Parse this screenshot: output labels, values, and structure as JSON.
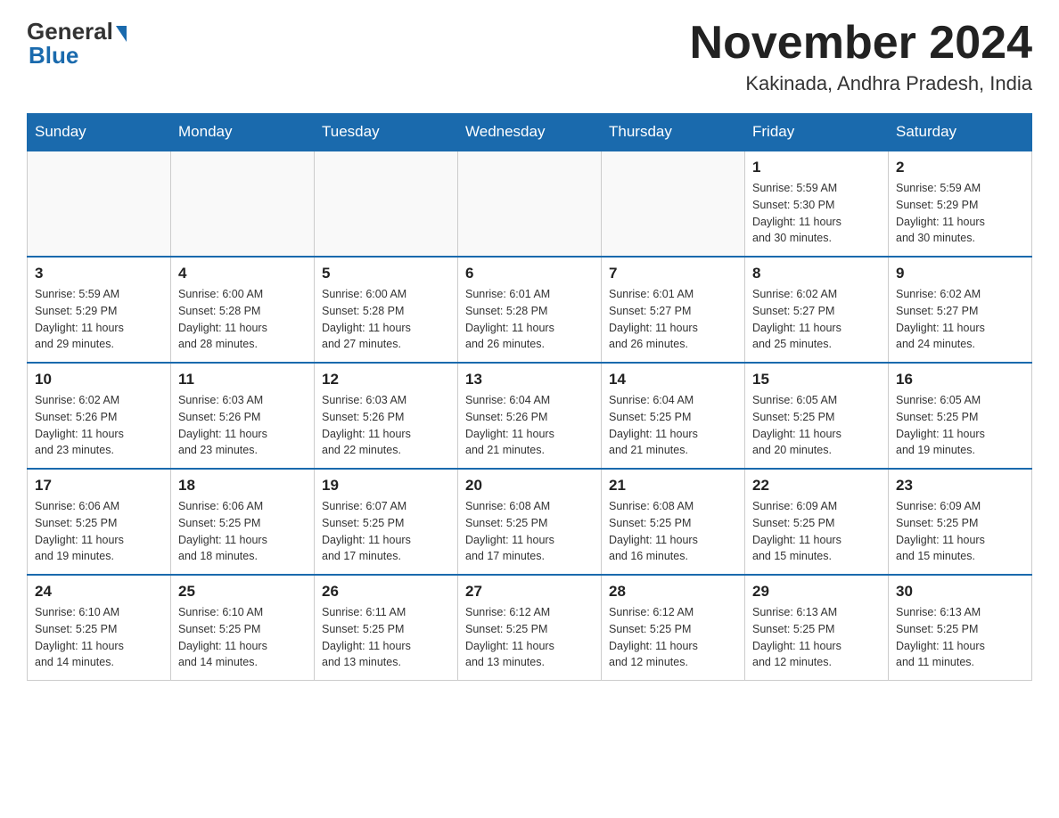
{
  "header": {
    "logo_general": "General",
    "logo_blue": "Blue",
    "month_title": "November 2024",
    "location": "Kakinada, Andhra Pradesh, India"
  },
  "days_of_week": [
    "Sunday",
    "Monday",
    "Tuesday",
    "Wednesday",
    "Thursday",
    "Friday",
    "Saturday"
  ],
  "weeks": [
    [
      {
        "day": "",
        "info": ""
      },
      {
        "day": "",
        "info": ""
      },
      {
        "day": "",
        "info": ""
      },
      {
        "day": "",
        "info": ""
      },
      {
        "day": "",
        "info": ""
      },
      {
        "day": "1",
        "info": "Sunrise: 5:59 AM\nSunset: 5:30 PM\nDaylight: 11 hours\nand 30 minutes."
      },
      {
        "day": "2",
        "info": "Sunrise: 5:59 AM\nSunset: 5:29 PM\nDaylight: 11 hours\nand 30 minutes."
      }
    ],
    [
      {
        "day": "3",
        "info": "Sunrise: 5:59 AM\nSunset: 5:29 PM\nDaylight: 11 hours\nand 29 minutes."
      },
      {
        "day": "4",
        "info": "Sunrise: 6:00 AM\nSunset: 5:28 PM\nDaylight: 11 hours\nand 28 minutes."
      },
      {
        "day": "5",
        "info": "Sunrise: 6:00 AM\nSunset: 5:28 PM\nDaylight: 11 hours\nand 27 minutes."
      },
      {
        "day": "6",
        "info": "Sunrise: 6:01 AM\nSunset: 5:28 PM\nDaylight: 11 hours\nand 26 minutes."
      },
      {
        "day": "7",
        "info": "Sunrise: 6:01 AM\nSunset: 5:27 PM\nDaylight: 11 hours\nand 26 minutes."
      },
      {
        "day": "8",
        "info": "Sunrise: 6:02 AM\nSunset: 5:27 PM\nDaylight: 11 hours\nand 25 minutes."
      },
      {
        "day": "9",
        "info": "Sunrise: 6:02 AM\nSunset: 5:27 PM\nDaylight: 11 hours\nand 24 minutes."
      }
    ],
    [
      {
        "day": "10",
        "info": "Sunrise: 6:02 AM\nSunset: 5:26 PM\nDaylight: 11 hours\nand 23 minutes."
      },
      {
        "day": "11",
        "info": "Sunrise: 6:03 AM\nSunset: 5:26 PM\nDaylight: 11 hours\nand 23 minutes."
      },
      {
        "day": "12",
        "info": "Sunrise: 6:03 AM\nSunset: 5:26 PM\nDaylight: 11 hours\nand 22 minutes."
      },
      {
        "day": "13",
        "info": "Sunrise: 6:04 AM\nSunset: 5:26 PM\nDaylight: 11 hours\nand 21 minutes."
      },
      {
        "day": "14",
        "info": "Sunrise: 6:04 AM\nSunset: 5:25 PM\nDaylight: 11 hours\nand 21 minutes."
      },
      {
        "day": "15",
        "info": "Sunrise: 6:05 AM\nSunset: 5:25 PM\nDaylight: 11 hours\nand 20 minutes."
      },
      {
        "day": "16",
        "info": "Sunrise: 6:05 AM\nSunset: 5:25 PM\nDaylight: 11 hours\nand 19 minutes."
      }
    ],
    [
      {
        "day": "17",
        "info": "Sunrise: 6:06 AM\nSunset: 5:25 PM\nDaylight: 11 hours\nand 19 minutes."
      },
      {
        "day": "18",
        "info": "Sunrise: 6:06 AM\nSunset: 5:25 PM\nDaylight: 11 hours\nand 18 minutes."
      },
      {
        "day": "19",
        "info": "Sunrise: 6:07 AM\nSunset: 5:25 PM\nDaylight: 11 hours\nand 17 minutes."
      },
      {
        "day": "20",
        "info": "Sunrise: 6:08 AM\nSunset: 5:25 PM\nDaylight: 11 hours\nand 17 minutes."
      },
      {
        "day": "21",
        "info": "Sunrise: 6:08 AM\nSunset: 5:25 PM\nDaylight: 11 hours\nand 16 minutes."
      },
      {
        "day": "22",
        "info": "Sunrise: 6:09 AM\nSunset: 5:25 PM\nDaylight: 11 hours\nand 15 minutes."
      },
      {
        "day": "23",
        "info": "Sunrise: 6:09 AM\nSunset: 5:25 PM\nDaylight: 11 hours\nand 15 minutes."
      }
    ],
    [
      {
        "day": "24",
        "info": "Sunrise: 6:10 AM\nSunset: 5:25 PM\nDaylight: 11 hours\nand 14 minutes."
      },
      {
        "day": "25",
        "info": "Sunrise: 6:10 AM\nSunset: 5:25 PM\nDaylight: 11 hours\nand 14 minutes."
      },
      {
        "day": "26",
        "info": "Sunrise: 6:11 AM\nSunset: 5:25 PM\nDaylight: 11 hours\nand 13 minutes."
      },
      {
        "day": "27",
        "info": "Sunrise: 6:12 AM\nSunset: 5:25 PM\nDaylight: 11 hours\nand 13 minutes."
      },
      {
        "day": "28",
        "info": "Sunrise: 6:12 AM\nSunset: 5:25 PM\nDaylight: 11 hours\nand 12 minutes."
      },
      {
        "day": "29",
        "info": "Sunrise: 6:13 AM\nSunset: 5:25 PM\nDaylight: 11 hours\nand 12 minutes."
      },
      {
        "day": "30",
        "info": "Sunrise: 6:13 AM\nSunset: 5:25 PM\nDaylight: 11 hours\nand 11 minutes."
      }
    ]
  ]
}
